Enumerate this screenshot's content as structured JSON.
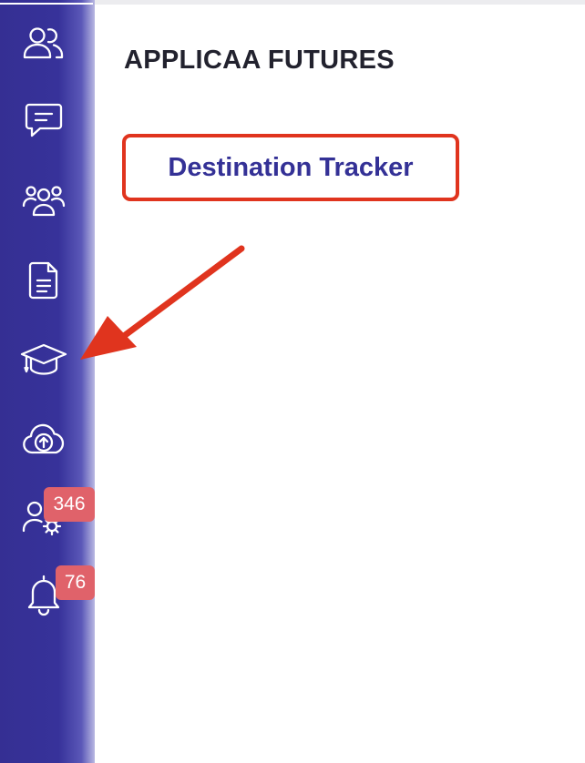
{
  "header": {
    "org_name": "APPLICAA FUTURES"
  },
  "main": {
    "highlighted_link": "Destination Tracker"
  },
  "sidebar": {
    "items": [
      {
        "icon": "users-icon"
      },
      {
        "icon": "message-icon"
      },
      {
        "icon": "team-icon"
      },
      {
        "icon": "document-icon"
      },
      {
        "icon": "graduation-cap-icon"
      },
      {
        "icon": "cloud-upload-icon"
      },
      {
        "icon": "user-settings-icon",
        "badge": "346"
      },
      {
        "icon": "bell-icon",
        "badge": "76"
      }
    ]
  },
  "annotations": {
    "arrow_color": "#e0341e",
    "highlight_color": "#e0341e"
  },
  "colors": {
    "sidebar": "#352f93",
    "link": "#343196",
    "badge": "#e0626a"
  }
}
